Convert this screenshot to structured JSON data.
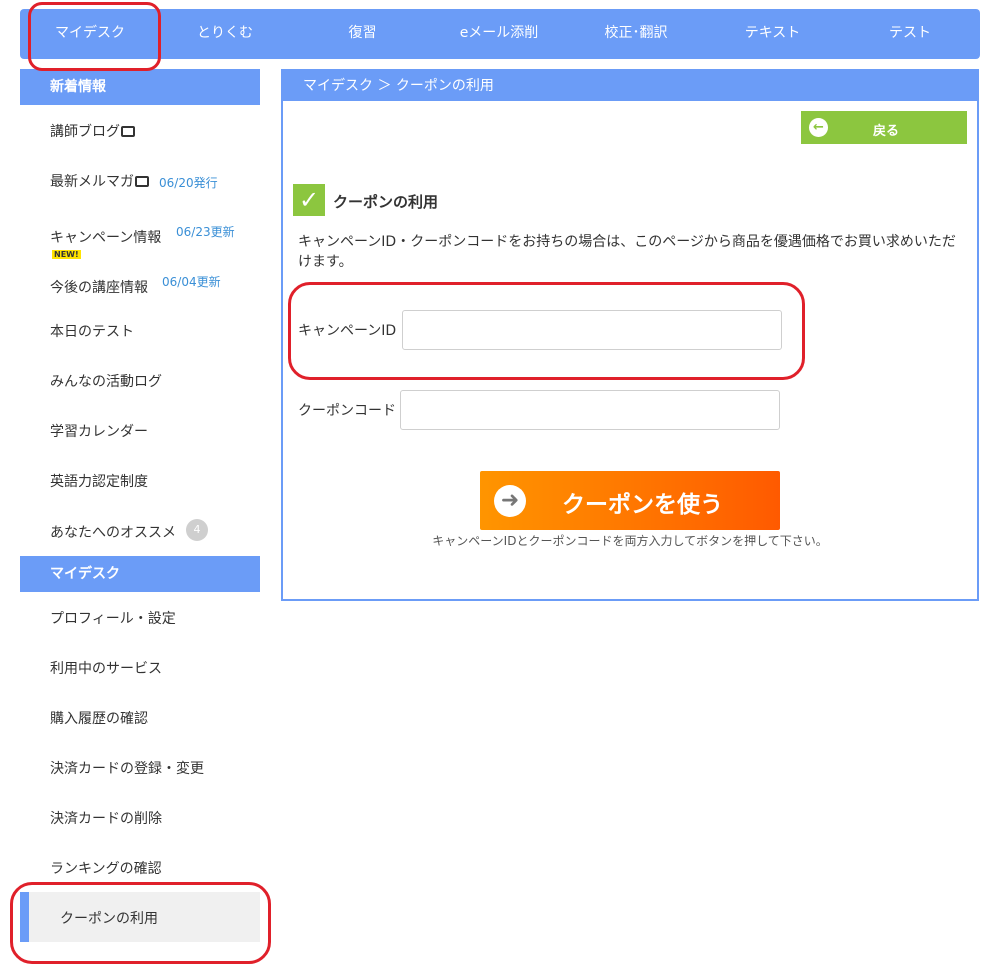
{
  "topnav": {
    "items": [
      "マイデスク",
      "とりくむ",
      "復習",
      "eメール添削",
      "校正･翻訳",
      "テキスト",
      "テスト"
    ]
  },
  "sidebar": {
    "news_header": "新着情報",
    "news_items": [
      {
        "label": "講師ブログ",
        "note": ""
      },
      {
        "label": "最新メルマガ",
        "note": "06/20発行"
      },
      {
        "label": "キャンペーン情報",
        "note": "06/23更新",
        "badge": "NEW!"
      },
      {
        "label": "今後の講座情報",
        "note": "06/04更新"
      },
      {
        "label": "本日のテスト"
      },
      {
        "label": "みんなの活動ログ"
      },
      {
        "label": "学習カレンダー"
      },
      {
        "label": "英語力認定制度"
      },
      {
        "label": "あなたへのオススメ",
        "count": "4"
      }
    ],
    "mydesk_header": "マイデスク",
    "mydesk_items": [
      {
        "label": "プロフィール・設定"
      },
      {
        "label": "利用中のサービス"
      },
      {
        "label": "購入履歴の確認"
      },
      {
        "label": "決済カードの登録・変更"
      },
      {
        "label": "決済カードの削除"
      },
      {
        "label": "ランキングの確認"
      },
      {
        "label": "クーポンの利用"
      }
    ]
  },
  "main": {
    "breadcrumb": "マイデスク ＞ クーポンの利用",
    "back_label": "戻る",
    "section_title": "クーポンの利用",
    "description": "キャンペーンID・クーポンコードをお持ちの場合は、このページから商品を優遇価格でお買い求めいただけます。",
    "campaign_id_label": "キャンペーンID",
    "campaign_id_value": "",
    "coupon_code_label": "クーポンコード",
    "coupon_code_value": "",
    "submit_label": "クーポンを使う",
    "hint": "キャンペーンIDとクーポンコードを両方入力してボタンを押して下さい。"
  },
  "colors": {
    "nav_blue": "#6b9cf7",
    "back_green": "#8cc63f",
    "button_orange": "#ff7a00",
    "annotation_red": "#e0202a",
    "date_note_blue": "#3a8fd6"
  }
}
